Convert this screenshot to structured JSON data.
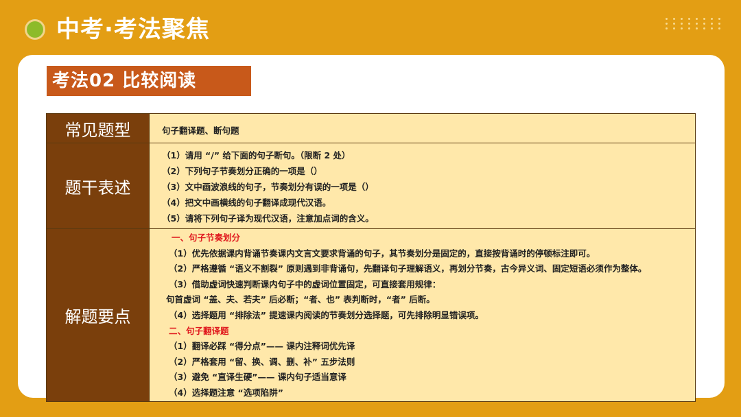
{
  "header": {
    "title": "中考·考法聚焦"
  },
  "section": {
    "tag": "考法02  比较阅读"
  },
  "table": {
    "row1": {
      "label": "常见题型",
      "content": "句子翻译题、断句题"
    },
    "row2": {
      "label": "题干表述",
      "lines": [
        "（1）请用 “/” 给下面的句子断句。（限断 2 处）",
        "（2）下列句子节奏划分正确的一项是（）",
        "（3）文中画波浪线的句子，节奏划分有误的一项是（）",
        "（4）把文中画横线的句子翻译成现代汉语。",
        "（5）请将下列句子译为现代汉语，注意加点词的含义。"
      ]
    },
    "row3": {
      "label": "解题要点",
      "heading1": "一、句子节奏划分",
      "part1": [
        "（1）优先依据课内背诵节奏课内文言文要求背诵的句子，其节奏划分是固定的，直接按背诵时的停顿标注即可。",
        "（2）严格遵循 “语义不割裂” 原则遇到非背诵句，先翻译句子理解语义，再划分节奏，古今异义词、固定短语必须作为整体。",
        "（3）借助虚词快速判断课内句子中的虚词位置固定，可直接套用规律："
      ],
      "part1_rule": "句首虚词 “盖、夫、若夫” 后必断；“者、也” 表判断时，“者” 后断。",
      "part1_last": "（4）选择题用 “排除法” 提速课内阅读的节奏划分选择题，可先排除明显错误项。",
      "heading2": "二、句子翻译题",
      "part2": [
        "（1）翻译必踩 “得分点”—— 课内注释词优先译",
        "（2）严格套用 “留、换、调、删、补” 五步法则",
        "（3）避免 “直译生硬”—— 课内句子适当意译",
        "（4）选择题注意 “选项陷阱”"
      ]
    }
  },
  "colors": {
    "background": "#E39E14",
    "tag": "#C8591A",
    "label_cell": "#7A3F0C",
    "content_cell": "#FFE8AA",
    "accent_red": "#E0191E",
    "dot": "#8DBB2A"
  }
}
